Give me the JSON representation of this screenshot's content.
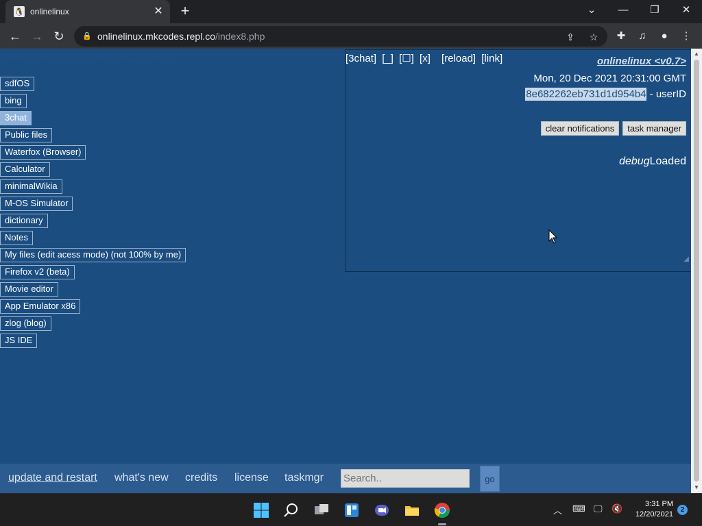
{
  "browser": {
    "tab_title": "onlinelinux",
    "url_host": "onlinelinux.mkcodes.repl.co",
    "url_path": "/index8.php"
  },
  "page": {
    "faint_header": "online linux (c) mkcodes 2021 - by mk",
    "apps": [
      {
        "label": "sdfOS"
      },
      {
        "label": "bing"
      },
      {
        "label": "3chat"
      },
      {
        "label": "Public files"
      },
      {
        "label": "Waterfox (Browser)"
      },
      {
        "label": "Calculator"
      },
      {
        "label": "minimalWikia"
      },
      {
        "label": "M-OS Simulator"
      },
      {
        "label": "dictionary"
      },
      {
        "label": "Notes"
      },
      {
        "label": "My files (edit acess mode) (not 100% by me)"
      },
      {
        "label": "Firefox v2 (beta)"
      },
      {
        "label": "Movie editor"
      },
      {
        "label": "App Emulator x86"
      },
      {
        "label": "zlog (blog)"
      },
      {
        "label": "JS IDE"
      }
    ],
    "selected_app": "3chat",
    "chat_window": {
      "name": "[3chat]",
      "minimize": "[_]",
      "maximize": "[☐]",
      "close": "[x]",
      "reload": "[reload]",
      "link": "[link]"
    },
    "title_link": "onlinelinux <v0.7>",
    "datetime": "Mon, 20 Dec 2021 20:31:00 GMT",
    "user_id": "8e682262eb731d1d954b4",
    "user_id_suffix": " - userID",
    "clear_notifications": "clear notifications",
    "task_manager": "task manager",
    "debug_label": "debug",
    "debug_status": "Loaded",
    "bottom": {
      "update": "update and restart",
      "whats_new": "what's new",
      "credits": "credits",
      "license": "license",
      "taskmgr": "taskmgr",
      "search_placeholder": "Search..",
      "go": "go"
    }
  },
  "taskbar": {
    "time": "3:31 PM",
    "date": "12/20/2021",
    "notifications": "2"
  },
  "colors": {
    "page_bg": "#1b4d81",
    "bottom_bar": "#2b5b8f",
    "selected_app": "#8fb3dd"
  }
}
